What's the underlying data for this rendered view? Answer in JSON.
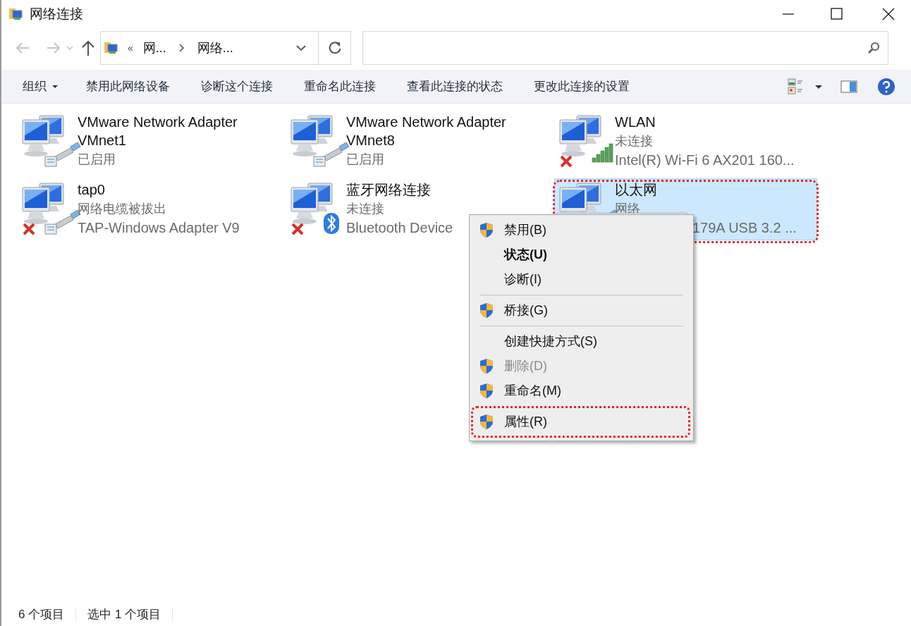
{
  "window": {
    "title": "网络连接"
  },
  "address": {
    "overflow_mark": "«",
    "crumbs": [
      "网...",
      "网络..."
    ]
  },
  "toolbar": {
    "items": [
      {
        "label": "组织",
        "dropdown": true
      },
      {
        "label": "禁用此网络设备",
        "dropdown": false
      },
      {
        "label": "诊断这个连接",
        "dropdown": false
      },
      {
        "label": "重命名此连接",
        "dropdown": false
      },
      {
        "label": "查看此连接的状态",
        "dropdown": false
      },
      {
        "label": "更改此连接的设置",
        "dropdown": false
      }
    ]
  },
  "adapters": [
    {
      "name": "VMware Network Adapter VMnet1",
      "status": "已启用",
      "kind": "wired",
      "disconnected": false,
      "selected": false
    },
    {
      "name": "VMware Network Adapter VMnet8",
      "status": "已启用",
      "kind": "wired",
      "disconnected": false,
      "selected": false
    },
    {
      "name": "WLAN",
      "status": "未连接",
      "device": "Intel(R) Wi-Fi 6 AX201 160...",
      "kind": "wifi",
      "disconnected": true,
      "selected": false
    },
    {
      "name": "tap0",
      "status": "网络电缆被拔出",
      "device": "TAP-Windows Adapter V9",
      "kind": "wired",
      "disconnected": true,
      "selected": false
    },
    {
      "name": "蓝牙网络连接",
      "status": "未连接",
      "device": "Bluetooth Device",
      "kind": "bluetooth",
      "disconnected": true,
      "selected": false
    },
    {
      "name": "以太网",
      "status": "网络",
      "device": "179A USB 3.2 ...",
      "kind": "wired",
      "disconnected": false,
      "selected": true,
      "annotated": true,
      "covered_left": true
    }
  ],
  "context_menu": {
    "items": [
      {
        "kind": "item",
        "label": "禁用(B)",
        "shield": true,
        "bold": false,
        "disabled": false
      },
      {
        "kind": "item",
        "label": "状态(U)",
        "shield": false,
        "bold": true,
        "disabled": false
      },
      {
        "kind": "item",
        "label": "诊断(I)",
        "shield": false,
        "bold": false,
        "disabled": false
      },
      {
        "kind": "separator"
      },
      {
        "kind": "item",
        "label": "桥接(G)",
        "shield": true,
        "bold": false,
        "disabled": false
      },
      {
        "kind": "separator"
      },
      {
        "kind": "item",
        "label": "创建快捷方式(S)",
        "shield": false,
        "bold": false,
        "disabled": false
      },
      {
        "kind": "item",
        "label": "删除(D)",
        "shield": true,
        "bold": false,
        "disabled": true
      },
      {
        "kind": "item",
        "label": "重命名(M)",
        "shield": true,
        "bold": false,
        "disabled": false
      },
      {
        "kind": "item",
        "label": "属性(R)",
        "shield": true,
        "bold": false,
        "disabled": false,
        "annotated": true
      }
    ]
  },
  "status_bar": {
    "count": "6 个项目",
    "selection": "选中 1 个项目"
  }
}
